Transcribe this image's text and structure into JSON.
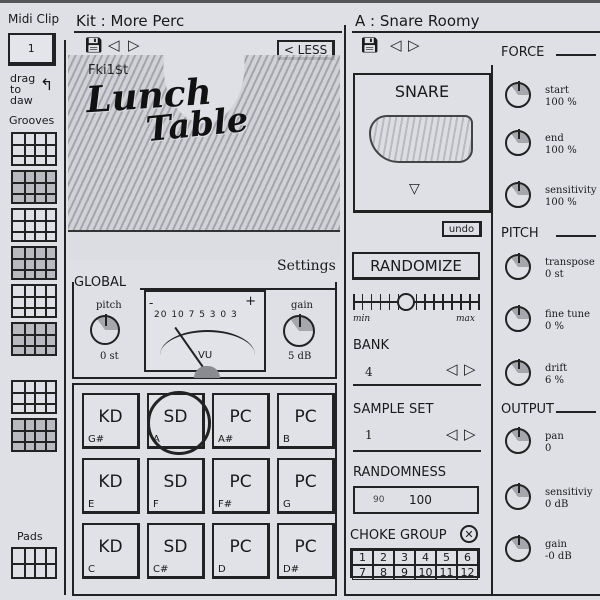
{
  "midi_clip": {
    "title": "Midi Clip",
    "value": "1",
    "hint": "drag to daw"
  },
  "grooves": {
    "title": "Grooves",
    "count": 8
  },
  "pads_panel": {
    "title": "Pads"
  },
  "kit": {
    "title": "Kit : More Perc",
    "less_label": "< LESS",
    "artwork": {
      "artist": "Fki1$t",
      "title_line1": "Lunch",
      "title_line2": "Table"
    },
    "settings_label": "Settings"
  },
  "global": {
    "title": "GLOBAL",
    "pitch": {
      "label": "pitch",
      "value": "0 st"
    },
    "gain": {
      "label": "gain",
      "value": "5 dB"
    },
    "vu": {
      "minus": "-",
      "plus": "+",
      "scale": "20 10 7 5 3 0 3",
      "label": "VU"
    }
  },
  "pads": [
    {
      "name": "KD",
      "note": "G#",
      "selected": false
    },
    {
      "name": "SD",
      "note": "A",
      "selected": true
    },
    {
      "name": "PC",
      "note": "A#",
      "selected": false
    },
    {
      "name": "PC",
      "note": "B",
      "selected": false
    },
    {
      "name": "KD",
      "note": "E",
      "selected": false
    },
    {
      "name": "SD",
      "note": "F",
      "selected": false
    },
    {
      "name": "PC",
      "note": "F#",
      "selected": false
    },
    {
      "name": "PC",
      "note": "G",
      "selected": false
    },
    {
      "name": "KD",
      "note": "C",
      "selected": false
    },
    {
      "name": "SD",
      "note": "C#",
      "selected": false
    },
    {
      "name": "PC",
      "note": "D",
      "selected": false
    },
    {
      "name": "PC",
      "note": "D#",
      "selected": false
    }
  ],
  "sample": {
    "title": "A : Snare Roomy",
    "name": "SNARE",
    "undo_label": "undo",
    "randomize_label": "RANDOMIZE",
    "randomize_amount": 0.42,
    "slider_min": "min",
    "slider_max": "max",
    "bank": {
      "label": "BANK",
      "value": "4"
    },
    "sample_set": {
      "label": "SAMPLE SET",
      "value": "1"
    },
    "randomness": {
      "label": "RANDOMNESS",
      "low": "90",
      "high": "100"
    },
    "choke_group": {
      "label": "CHOKE GROUP",
      "clear": "✕",
      "cells": [
        "1",
        "2",
        "3",
        "4",
        "5",
        "6",
        "7",
        "8",
        "9",
        "10",
        "11",
        "12"
      ]
    }
  },
  "force": {
    "title": "FORCE",
    "knobs": [
      {
        "label": "start",
        "value": "100 %"
      },
      {
        "label": "end",
        "value": "100 %"
      },
      {
        "label": "sensitivity",
        "value": "100 %"
      }
    ]
  },
  "pitch": {
    "title": "PITCH",
    "knobs": [
      {
        "label": "transpose",
        "value": "0 st"
      },
      {
        "label": "fine tune",
        "value": "0 %"
      },
      {
        "label": "drift",
        "value": "6 %"
      }
    ]
  },
  "output": {
    "title": "OUTPUT",
    "knobs": [
      {
        "label": "pan",
        "value": "0"
      },
      {
        "label": "sensitiviy",
        "value": "0 dB"
      },
      {
        "label": "gain",
        "value": "-0 dB"
      }
    ]
  },
  "icons": {
    "save": "floppy-disk",
    "prev": "triangle-left",
    "next": "triangle-right",
    "dropdown": "triangle-down"
  }
}
